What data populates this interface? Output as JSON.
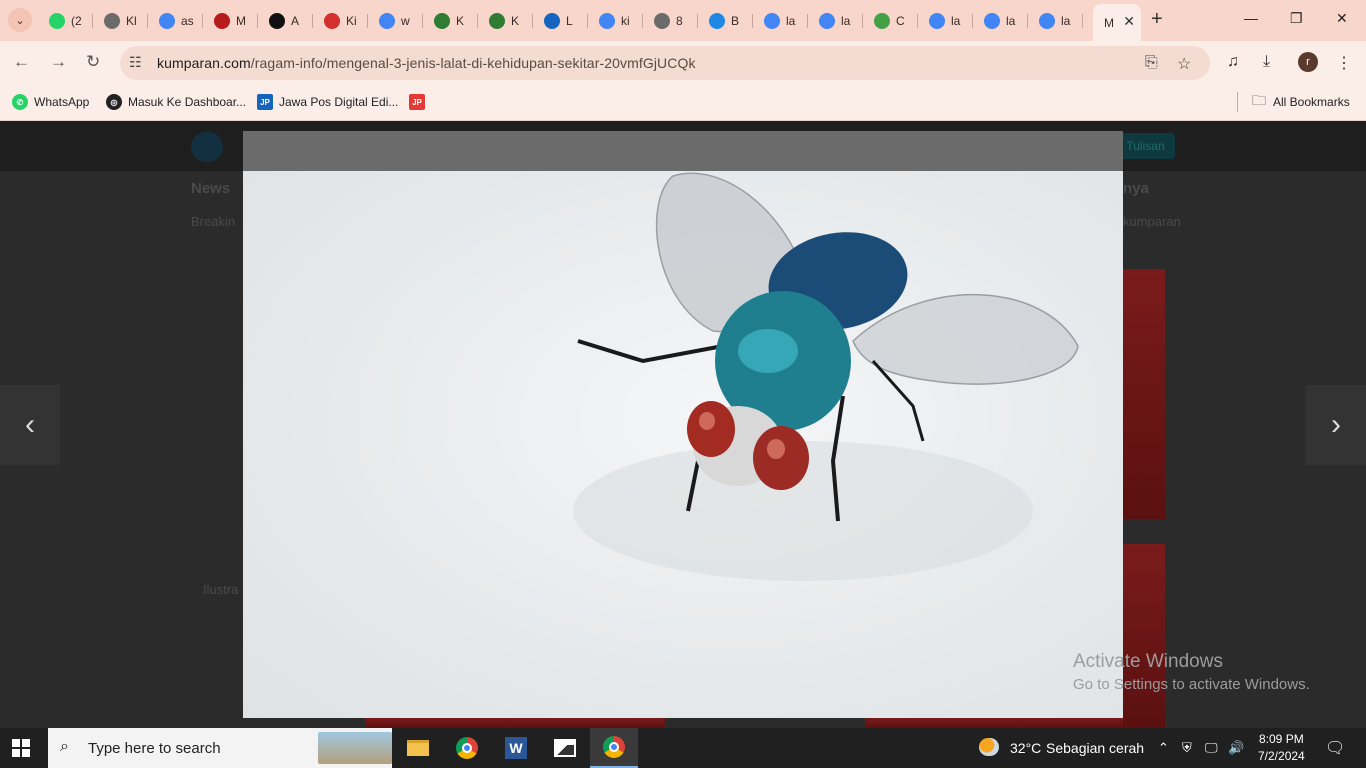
{
  "browser": {
    "tabs": [
      {
        "label": "(2",
        "icon": "whatsapp-icon",
        "color": "#25d366"
      },
      {
        "label": "Kl",
        "icon": "globe-icon",
        "color": "#6b6b6b"
      },
      {
        "label": "as",
        "icon": "google-icon",
        "color": "#4285f4"
      },
      {
        "label": "M",
        "icon": "train-icon",
        "color": "#b71c1c"
      },
      {
        "label": "A",
        "icon": "s-icon",
        "color": "#111111"
      },
      {
        "label": "Ki",
        "icon": "md-icon",
        "color": "#d32f2f"
      },
      {
        "label": "w",
        "icon": "google-icon",
        "color": "#4285f4"
      },
      {
        "label": "K",
        "icon": "emblem-icon",
        "color": "#2e7d32"
      },
      {
        "label": "K",
        "icon": "emblem-icon",
        "color": "#2e7d32"
      },
      {
        "label": "L",
        "icon": "d-icon",
        "color": "#1565c0"
      },
      {
        "label": "ki",
        "icon": "google-icon",
        "color": "#4285f4"
      },
      {
        "label": "8",
        "icon": "globe-icon",
        "color": "#6b6b6b"
      },
      {
        "label": "B",
        "icon": "b-icon",
        "color": "#1e88e5"
      },
      {
        "label": "la",
        "icon": "google-icon",
        "color": "#4285f4"
      },
      {
        "label": "la",
        "icon": "google-icon",
        "color": "#4285f4"
      },
      {
        "label": "C",
        "icon": "c-icon",
        "color": "#43a047"
      },
      {
        "label": "la",
        "icon": "google-icon",
        "color": "#4285f4"
      },
      {
        "label": "la",
        "icon": "google-icon",
        "color": "#4285f4"
      },
      {
        "label": "la",
        "icon": "google-icon",
        "color": "#4285f4"
      }
    ],
    "active_tab": {
      "label": "M"
    },
    "url": {
      "host": "kumparan.com",
      "path": "/ragam-info/mengenal-3-jenis-lalat-di-kehidupan-sekitar-20vmfGjUCQk"
    },
    "profile_initial": "r",
    "bookmarks": [
      {
        "label": "WhatsApp",
        "color": "#25d366",
        "icon": "whatsapp-icon"
      },
      {
        "label": "Masuk Ke Dashboar...",
        "color": "#222222",
        "icon": "globe-icon"
      },
      {
        "label": "Jawa Pos Digital Edi...",
        "color": "#1565c0",
        "icon": "jp-icon"
      },
      {
        "label": "",
        "color": "#e53935",
        "icon": "jps-icon"
      }
    ],
    "all_bookmarks_label": "All Bookmarks"
  },
  "page": {
    "dim_texts": {
      "news": "News",
      "breaking": "Breakin",
      "lainnya": "nya",
      "kumparan": "kumparan",
      "ilustrasi": "Ilustra",
      "tulisan": "Tulisan"
    },
    "lightbox": {
      "image": "blue bottle fly photo"
    },
    "activate_windows": {
      "title": "Activate Windows",
      "subtitle": "Go to Settings to activate Windows."
    }
  },
  "taskbar": {
    "search_placeholder": "Type here to search",
    "weather": {
      "temp": "32°C",
      "desc": "Sebagian cerah"
    },
    "time": "8:09 PM",
    "date": "7/2/2024",
    "apps": [
      "file-explorer-icon",
      "chrome-icon",
      "word-icon",
      "photos-icon",
      "chrome-profile-icon"
    ]
  }
}
